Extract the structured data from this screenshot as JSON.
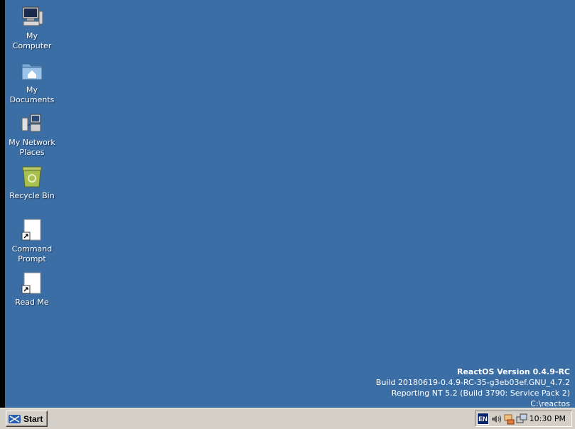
{
  "desktop": {
    "icons": [
      {
        "label_lines": [
          "My",
          "Computer"
        ],
        "icon": "computer-icon"
      },
      {
        "label_lines": [
          "My",
          "Documents"
        ],
        "icon": "folder-home-icon"
      },
      {
        "label_lines": [
          "My Network",
          "Places"
        ],
        "icon": "network-icon"
      },
      {
        "label_lines": [
          "Recycle Bin"
        ],
        "icon": "recycle-bin-icon"
      },
      {
        "label_lines": [
          "Command",
          "Prompt"
        ],
        "icon": "shortcut-file-icon"
      },
      {
        "label_lines": [
          "Read Me"
        ],
        "icon": "shortcut-file-icon"
      }
    ],
    "background_color": "#3a6ea5"
  },
  "version_info": {
    "title": "ReactOS Version 0.4.9-RC",
    "build": "Build 20180619-0.4.9-RC-35-g3eb03ef.GNU_4.7.2",
    "reporting": "Reporting NT 5.2 (Build 3790: Service Pack 2)",
    "path": "C:\\reactos"
  },
  "taskbar": {
    "start_label": "Start",
    "tray": {
      "language": "EN",
      "icons": [
        "volume-icon",
        "network-status-icon",
        "display-icon"
      ],
      "clock": "10:30 PM"
    }
  }
}
